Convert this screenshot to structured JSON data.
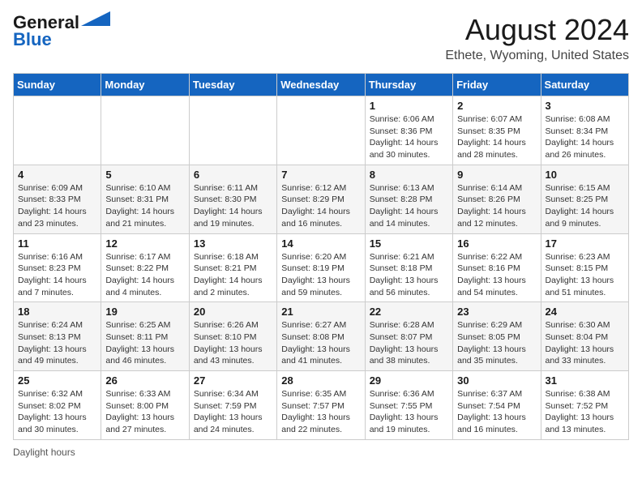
{
  "logo": {
    "line1": "General",
    "line2": "Blue"
  },
  "title": "August 2024",
  "subtitle": "Ethete, Wyoming, United States",
  "weekdays": [
    "Sunday",
    "Monday",
    "Tuesday",
    "Wednesday",
    "Thursday",
    "Friday",
    "Saturday"
  ],
  "weeks": [
    [
      {
        "day": "",
        "sunrise": "",
        "sunset": "",
        "daylight": ""
      },
      {
        "day": "",
        "sunrise": "",
        "sunset": "",
        "daylight": ""
      },
      {
        "day": "",
        "sunrise": "",
        "sunset": "",
        "daylight": ""
      },
      {
        "day": "",
        "sunrise": "",
        "sunset": "",
        "daylight": ""
      },
      {
        "day": "1",
        "sunrise": "Sunrise: 6:06 AM",
        "sunset": "Sunset: 8:36 PM",
        "daylight": "Daylight: 14 hours and 30 minutes."
      },
      {
        "day": "2",
        "sunrise": "Sunrise: 6:07 AM",
        "sunset": "Sunset: 8:35 PM",
        "daylight": "Daylight: 14 hours and 28 minutes."
      },
      {
        "day": "3",
        "sunrise": "Sunrise: 6:08 AM",
        "sunset": "Sunset: 8:34 PM",
        "daylight": "Daylight: 14 hours and 26 minutes."
      }
    ],
    [
      {
        "day": "4",
        "sunrise": "Sunrise: 6:09 AM",
        "sunset": "Sunset: 8:33 PM",
        "daylight": "Daylight: 14 hours and 23 minutes."
      },
      {
        "day": "5",
        "sunrise": "Sunrise: 6:10 AM",
        "sunset": "Sunset: 8:31 PM",
        "daylight": "Daylight: 14 hours and 21 minutes."
      },
      {
        "day": "6",
        "sunrise": "Sunrise: 6:11 AM",
        "sunset": "Sunset: 8:30 PM",
        "daylight": "Daylight: 14 hours and 19 minutes."
      },
      {
        "day": "7",
        "sunrise": "Sunrise: 6:12 AM",
        "sunset": "Sunset: 8:29 PM",
        "daylight": "Daylight: 14 hours and 16 minutes."
      },
      {
        "day": "8",
        "sunrise": "Sunrise: 6:13 AM",
        "sunset": "Sunset: 8:28 PM",
        "daylight": "Daylight: 14 hours and 14 minutes."
      },
      {
        "day": "9",
        "sunrise": "Sunrise: 6:14 AM",
        "sunset": "Sunset: 8:26 PM",
        "daylight": "Daylight: 14 hours and 12 minutes."
      },
      {
        "day": "10",
        "sunrise": "Sunrise: 6:15 AM",
        "sunset": "Sunset: 8:25 PM",
        "daylight": "Daylight: 14 hours and 9 minutes."
      }
    ],
    [
      {
        "day": "11",
        "sunrise": "Sunrise: 6:16 AM",
        "sunset": "Sunset: 8:23 PM",
        "daylight": "Daylight: 14 hours and 7 minutes."
      },
      {
        "day": "12",
        "sunrise": "Sunrise: 6:17 AM",
        "sunset": "Sunset: 8:22 PM",
        "daylight": "Daylight: 14 hours and 4 minutes."
      },
      {
        "day": "13",
        "sunrise": "Sunrise: 6:18 AM",
        "sunset": "Sunset: 8:21 PM",
        "daylight": "Daylight: 14 hours and 2 minutes."
      },
      {
        "day": "14",
        "sunrise": "Sunrise: 6:20 AM",
        "sunset": "Sunset: 8:19 PM",
        "daylight": "Daylight: 13 hours and 59 minutes."
      },
      {
        "day": "15",
        "sunrise": "Sunrise: 6:21 AM",
        "sunset": "Sunset: 8:18 PM",
        "daylight": "Daylight: 13 hours and 56 minutes."
      },
      {
        "day": "16",
        "sunrise": "Sunrise: 6:22 AM",
        "sunset": "Sunset: 8:16 PM",
        "daylight": "Daylight: 13 hours and 54 minutes."
      },
      {
        "day": "17",
        "sunrise": "Sunrise: 6:23 AM",
        "sunset": "Sunset: 8:15 PM",
        "daylight": "Daylight: 13 hours and 51 minutes."
      }
    ],
    [
      {
        "day": "18",
        "sunrise": "Sunrise: 6:24 AM",
        "sunset": "Sunset: 8:13 PM",
        "daylight": "Daylight: 13 hours and 49 minutes."
      },
      {
        "day": "19",
        "sunrise": "Sunrise: 6:25 AM",
        "sunset": "Sunset: 8:11 PM",
        "daylight": "Daylight: 13 hours and 46 minutes."
      },
      {
        "day": "20",
        "sunrise": "Sunrise: 6:26 AM",
        "sunset": "Sunset: 8:10 PM",
        "daylight": "Daylight: 13 hours and 43 minutes."
      },
      {
        "day": "21",
        "sunrise": "Sunrise: 6:27 AM",
        "sunset": "Sunset: 8:08 PM",
        "daylight": "Daylight: 13 hours and 41 minutes."
      },
      {
        "day": "22",
        "sunrise": "Sunrise: 6:28 AM",
        "sunset": "Sunset: 8:07 PM",
        "daylight": "Daylight: 13 hours and 38 minutes."
      },
      {
        "day": "23",
        "sunrise": "Sunrise: 6:29 AM",
        "sunset": "Sunset: 8:05 PM",
        "daylight": "Daylight: 13 hours and 35 minutes."
      },
      {
        "day": "24",
        "sunrise": "Sunrise: 6:30 AM",
        "sunset": "Sunset: 8:04 PM",
        "daylight": "Daylight: 13 hours and 33 minutes."
      }
    ],
    [
      {
        "day": "25",
        "sunrise": "Sunrise: 6:32 AM",
        "sunset": "Sunset: 8:02 PM",
        "daylight": "Daylight: 13 hours and 30 minutes."
      },
      {
        "day": "26",
        "sunrise": "Sunrise: 6:33 AM",
        "sunset": "Sunset: 8:00 PM",
        "daylight": "Daylight: 13 hours and 27 minutes."
      },
      {
        "day": "27",
        "sunrise": "Sunrise: 6:34 AM",
        "sunset": "Sunset: 7:59 PM",
        "daylight": "Daylight: 13 hours and 24 minutes."
      },
      {
        "day": "28",
        "sunrise": "Sunrise: 6:35 AM",
        "sunset": "Sunset: 7:57 PM",
        "daylight": "Daylight: 13 hours and 22 minutes."
      },
      {
        "day": "29",
        "sunrise": "Sunrise: 6:36 AM",
        "sunset": "Sunset: 7:55 PM",
        "daylight": "Daylight: 13 hours and 19 minutes."
      },
      {
        "day": "30",
        "sunrise": "Sunrise: 6:37 AM",
        "sunset": "Sunset: 7:54 PM",
        "daylight": "Daylight: 13 hours and 16 minutes."
      },
      {
        "day": "31",
        "sunrise": "Sunrise: 6:38 AM",
        "sunset": "Sunset: 7:52 PM",
        "daylight": "Daylight: 13 hours and 13 minutes."
      }
    ]
  ],
  "footer": "Daylight hours"
}
